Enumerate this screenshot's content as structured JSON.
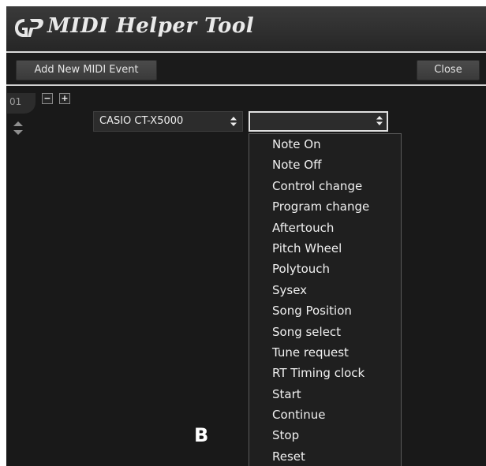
{
  "app": {
    "title": "MIDI Helper Tool",
    "logo_icon": "gp-logo-icon"
  },
  "toolbar": {
    "add_label": "Add New MIDI Event",
    "close_label": "Close"
  },
  "event_row": {
    "number": "01",
    "device": "CASIO CT-X5000",
    "event_type": ""
  },
  "dropdown": {
    "items": [
      "Note On",
      "Note Off",
      "Control change",
      "Program change",
      "Aftertouch",
      "Pitch Wheel",
      "Polytouch",
      "Sysex",
      "Song Position",
      "Song select",
      "Tune request",
      "RT Timing clock",
      "Start",
      "Continue",
      "Stop",
      "Reset"
    ]
  },
  "annotation": "B",
  "colors": {
    "background": "#191919",
    "titlebar": "#2f2f2f",
    "accent_line": "#d9d9d9",
    "text": "#f0f0f0"
  }
}
